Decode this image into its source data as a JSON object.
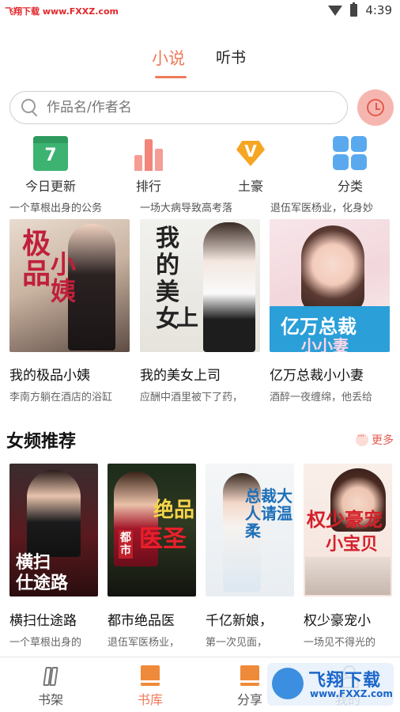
{
  "status_bar": {
    "watermark": "飞翔下载 www.FXXZ.com",
    "time": "4:39"
  },
  "tabs": [
    {
      "label": "小说",
      "active": true
    },
    {
      "label": "听书",
      "active": false
    }
  ],
  "search": {
    "placeholder": "作品名/作者名"
  },
  "categories": [
    {
      "label": "今日更新",
      "icon": "calendar-icon",
      "icon_text": "7"
    },
    {
      "label": "排行",
      "icon": "rank-icon"
    },
    {
      "label": "土豪",
      "icon": "vip-diamond-icon",
      "icon_text": "V"
    },
    {
      "label": "分类",
      "icon": "grid-icon"
    }
  ],
  "category_descs": [
    "一个草根出身的公务",
    "一场大病导致高考落",
    "退伍军医杨业，化身妙"
  ],
  "featured_books": [
    {
      "title": "我的极品小姨",
      "desc": "李南方躺在酒店的浴缸",
      "cover_text": "我的极品小姨"
    },
    {
      "title": "我的美女上司",
      "desc": "应酬中酒里被下了药，",
      "cover_text": "我的美女上司"
    },
    {
      "title": "亿万总裁小小妻",
      "desc": "酒醉一夜缠绵，他丢给",
      "cover_text": "亿万总裁"
    }
  ],
  "section": {
    "title": "女频推荐",
    "more_label": "更多"
  },
  "recommended_books": [
    {
      "title": "横扫仕途路",
      "desc": "一个草根出身的",
      "cover_text": "横扫仕途路"
    },
    {
      "title": "都市绝品医",
      "desc": "退伍军医杨业，",
      "cover_text": "都市绝品医圣"
    },
    {
      "title": "千亿新娘，",
      "desc": "第一次见面，",
      "cover_text": "总裁大人请温柔"
    },
    {
      "title": "权少豪宠小",
      "desc": "一场见不得光的",
      "cover_text": "权少豪宠小宝贝"
    }
  ],
  "bottom_nav": [
    {
      "label": "书架",
      "active": false
    },
    {
      "label": "书库",
      "active": true
    },
    {
      "label": "分享",
      "active": false
    },
    {
      "label": "我的",
      "active": false
    }
  ],
  "bottom_watermark": {
    "text": "飞翔下载",
    "url": "www.FXXZ.com"
  },
  "colors": {
    "accent": "#ef7a5a",
    "history_button_bg": "#f6b6b0"
  }
}
